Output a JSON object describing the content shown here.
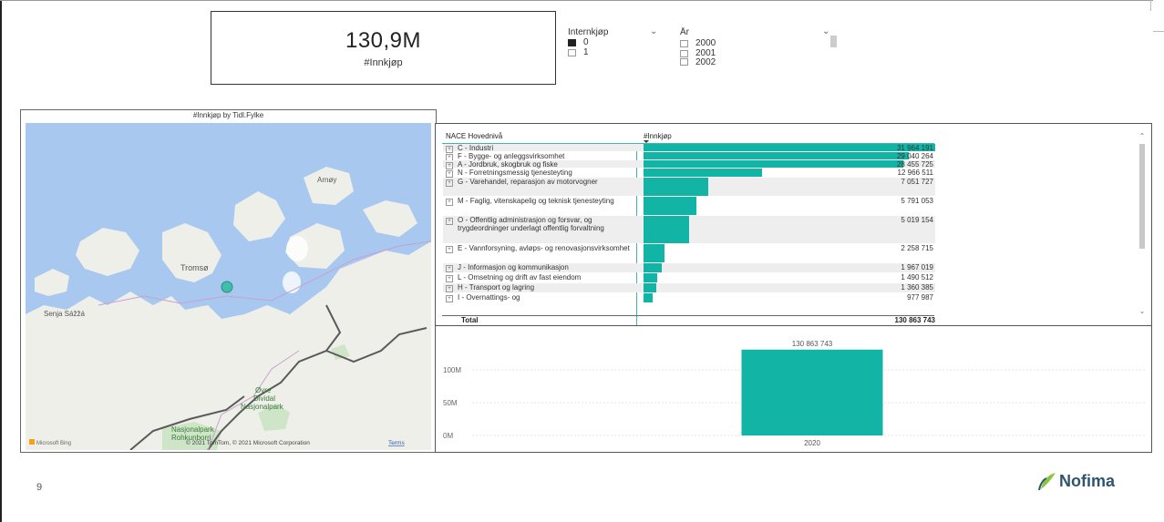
{
  "kpi": {
    "value": "130,9M",
    "label": "#Innkjøp"
  },
  "slicers": {
    "internkjop": {
      "title": "Internkjøp",
      "options": [
        {
          "label": "0",
          "checked": true
        },
        {
          "label": "1",
          "checked": false
        }
      ]
    },
    "ar": {
      "title": "År",
      "options": [
        {
          "label": "2000",
          "checked": false
        },
        {
          "label": "2001",
          "checked": false
        },
        {
          "label": "2002",
          "checked": false
        }
      ]
    }
  },
  "map": {
    "title": "#Innkjøp by Tidl.Fylke",
    "labels": {
      "arnoy": "Arnøy",
      "tromso": "Tromsø",
      "senja": "Senja Sážžá",
      "dividal_1": "Øvre",
      "dividal_2": "Dividal",
      "dividal_3": "Nasjonalpark",
      "rohk_1": "Nasjonalpark",
      "rohk_2": "Rohkunborri"
    },
    "attribution": "© 2021 TomTom, © 2021 Microsoft Corporation",
    "terms": "Terms",
    "bing": "Microsoft Bing",
    "colors": {
      "water": "#a8c8ef",
      "land": "#efefe9",
      "border": "#5a5a5a",
      "marker": "#3fbfaa"
    }
  },
  "table": {
    "headers": {
      "nace": "NACE Hovednivå",
      "innkjop": "#Innkjøp"
    },
    "rows": [
      {
        "label": "C - Industri",
        "value": "31 964 191",
        "amount": 31964191
      },
      {
        "label": "F - Bygge- og anleggsvirksomhet",
        "value": "29 040 264",
        "amount": 29040264
      },
      {
        "label": "A - Jordbruk, skogbruk og fiske",
        "value": "28 455 725",
        "amount": 28455725
      },
      {
        "label": "N - Forretningsmessig tjenesteyting",
        "value": "12 966 511",
        "amount": 12966511
      },
      {
        "label": "G - Varehandel, reparasjon av motorvogner",
        "value": "7 051 727",
        "amount": 7051727
      },
      {
        "label": "M - Faglig, vitenskapelig og teknisk tjenesteyting",
        "value": "5 791 053",
        "amount": 5791053
      },
      {
        "label": "O - Offentlig administrasjon og forsvar, og trygdeordninger underlagt offentlig forvaltning",
        "value": "5 019 154",
        "amount": 5019154
      },
      {
        "label": "E - Vannforsyning, avløps- og renovasjonsvirksomhet",
        "value": "2 258 715",
        "amount": 2258715
      },
      {
        "label": "J - Informasjon og kommunikasjon",
        "value": "1 967 019",
        "amount": 1967019
      },
      {
        "label": "L - Omsetning og drift av fast eiendom",
        "value": "1 490 512",
        "amount": 1490512
      },
      {
        "label": "H - Transport og lagring",
        "value": "1 360 385",
        "amount": 1360385
      },
      {
        "label": "I - Overnattings- og",
        "value": "977 987",
        "amount": 977987
      }
    ],
    "total": {
      "label": "Total",
      "value": "130 863 743"
    },
    "bar_color": "#12b5a5"
  },
  "chart_data": {
    "type": "bar",
    "categories": [
      "2020"
    ],
    "values": [
      130863743
    ],
    "data_labels": [
      "130 863 743"
    ],
    "tick_labels": [
      "0M",
      "50M",
      "100M"
    ],
    "ticks": [
      0,
      50000000,
      100000000
    ],
    "ylim": [
      0,
      150000000
    ],
    "color": "#12b5a5"
  },
  "page": {
    "number": "9"
  },
  "brand": {
    "name": "Nofima"
  }
}
